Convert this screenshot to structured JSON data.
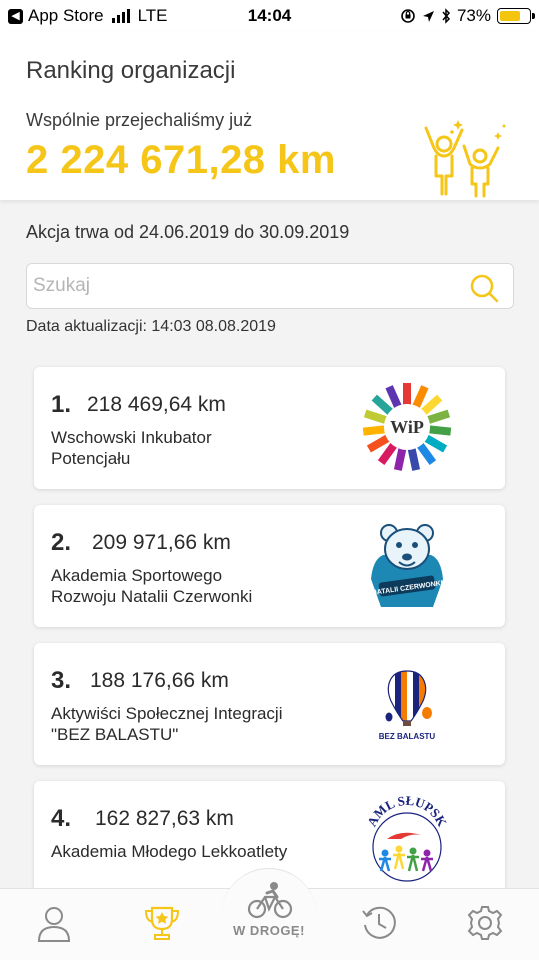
{
  "status_bar": {
    "back_app": "App Store",
    "network": "LTE",
    "time": "14:04",
    "battery": "73%",
    "battery_level": 0.73
  },
  "header": {
    "title": "Ranking organizacji",
    "total_label": "Wspólnie przejechaliśmy już",
    "total_value": "2 224 671,28 km"
  },
  "campaign": {
    "dates": "Akcja trwa od 24.06.2019 do 30.09.2019"
  },
  "search": {
    "placeholder": "Szukaj",
    "value": ""
  },
  "update_info": "Data aktualizacji: 14:03 08.08.2019",
  "ranking": [
    {
      "position": "1.",
      "km": "218 469,64 km",
      "name": "Wschowski Inkubator\nPotencjału",
      "logo": "wip-logo"
    },
    {
      "position": "2.",
      "km": "209 971,66 km",
      "name": "Akademia Sportowego\nRozwoju Natalii Czerwonki",
      "logo": "polar-bear-logo"
    },
    {
      "position": "3.",
      "km": "188 176,66 km",
      "name": "Aktywiści Społecznej Integracji\n\"BEZ BALASTU\"",
      "logo": "hot-air-balloon-logo"
    },
    {
      "position": "4.",
      "km": "162 827,63 km",
      "name": "Akademia Młodego Lekkoatlety",
      "logo": "aml-slupsk-logo"
    }
  ],
  "logos": {
    "bez_balastu_text": "BEZ BALASTU",
    "aml_text": "AML SŁUPSK",
    "wip_text": "WiP",
    "bear_text": "NATALII CZERWONKI"
  },
  "bottom_nav": {
    "ride_label": "W DROGĘ!",
    "items": [
      "profile-icon",
      "trophy-icon",
      "bicycle-icon",
      "history-icon",
      "gear-icon"
    ],
    "active": "trophy-icon"
  },
  "colors": {
    "accent": "#f5c518",
    "text": "#2b2b2b",
    "nav_inactive": "#8a8a8a"
  }
}
